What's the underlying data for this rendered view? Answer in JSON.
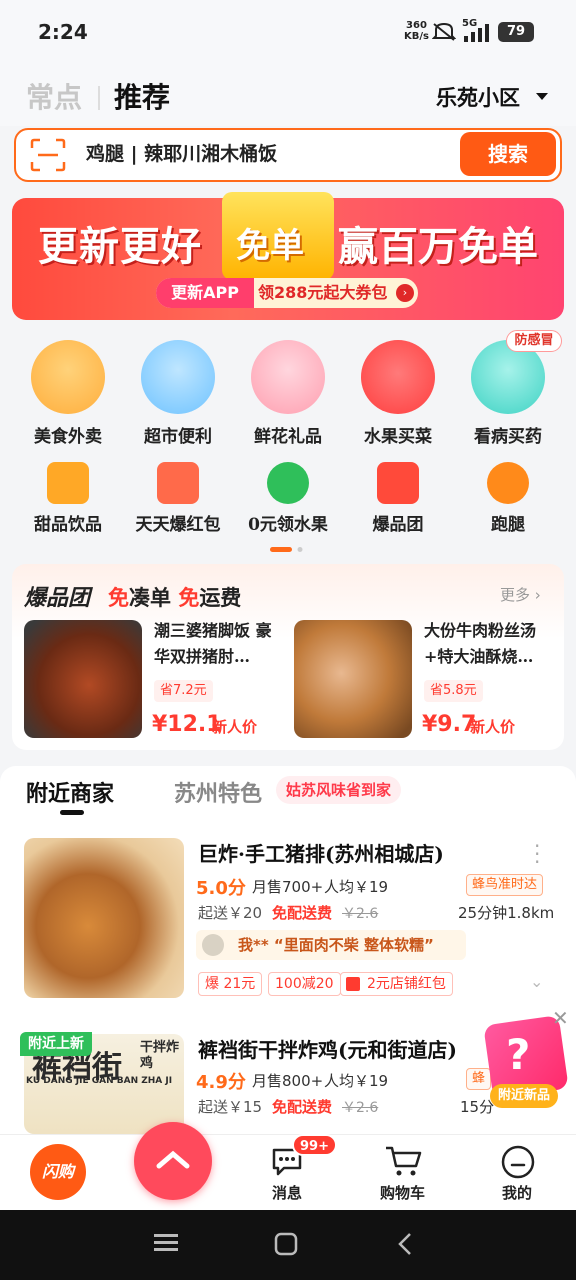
{
  "status_bar": {
    "time": "2:24",
    "speed_value": "360",
    "speed_unit": "KB/s",
    "network": "5G",
    "battery": "79"
  },
  "header": {
    "tab_frequent": "常点",
    "tab_recommend": "推荐",
    "location": "乐苑小区"
  },
  "search": {
    "placeholder": "鸡腿 | 辣耶川湘木桶饭",
    "button": "搜索"
  },
  "banner": {
    "left_text": "更新更好",
    "center_text": "免单",
    "right_text": "赢百万免单",
    "pill_left": "更新APP",
    "pill_right": "领288元起大券包"
  },
  "categories_row1": [
    {
      "label": "美食外卖",
      "icon": "noodle-bowl-icon",
      "color": "#ffb547"
    },
    {
      "label": "超市便利",
      "icon": "milk-carton-icon",
      "color": "#6fc3ff"
    },
    {
      "label": "鲜花礼品",
      "icon": "flower-bouquet-icon",
      "color": "#ff9fb0"
    },
    {
      "label": "水果买菜",
      "icon": "strawberry-icon",
      "color": "#ff5a5a"
    },
    {
      "label": "看病买药",
      "icon": "medicine-bottle-icon",
      "color": "#3fd3c4"
    }
  ],
  "categories_row2": [
    {
      "label": "甜品饮品",
      "icon": "drink-cup-icon",
      "color": "#ffa826"
    },
    {
      "label": "天天爆红包",
      "icon": "red-packet-icon",
      "color": "#ff6a4a"
    },
    {
      "label": "0元领水果",
      "icon": "tree-icon",
      "color": "#2fbf5a"
    },
    {
      "label": "爆品团",
      "icon": "group-buy-icon",
      "color": "#ff4a3a"
    },
    {
      "label": "跑腿",
      "icon": "runner-icon",
      "color": "#ff8a1a"
    }
  ],
  "medicine_badge": "防感冒",
  "baopin": {
    "logo": "爆品团",
    "tagline_a": "免",
    "tagline_b": "凑单",
    "tagline_c": "免",
    "tagline_d": "运费",
    "more": "更多",
    "deals": [
      {
        "title": "潮三婆猪脚饭 豪华双拼猪肘…",
        "save": "省7.2元",
        "price": "¥12.1",
        "tag": "新人价"
      },
      {
        "title": "大份牛肉粉丝汤+特大油酥烧…",
        "save": "省5.8元",
        "price": "¥9.7",
        "tag": "新人价"
      }
    ]
  },
  "merchant_tabs": {
    "nearby": "附近商家",
    "suzhou": "苏州特色",
    "suzhou_badge": "姑苏风味省到家"
  },
  "shops": [
    {
      "name": "巨炸·手工猪排(苏州相城店)",
      "rating": "5.0分",
      "monthly": "月售700+",
      "avg": "人均￥19",
      "delivery_tag": "蜂鸟准时达",
      "min_order": "起送￥20",
      "free_fee": "免配送费",
      "old_fee": "￥2.6",
      "eta": "25分钟1.8km",
      "review": "我** “里面肉不柴 整体软糯”",
      "promos": [
        "爆 21元",
        "100减20",
        "2元店铺红包"
      ]
    },
    {
      "name": "裤裆街干拌炸鸡(元和街道店)",
      "badge": "附近上新",
      "rating": "4.9分",
      "monthly": "月售800+",
      "avg": "人均￥19",
      "delivery_tag": "蜂",
      "min_order": "起送￥15",
      "free_fee": "免配送费",
      "old_fee": "￥2.6",
      "eta": "15分",
      "img_text_a": "裤裆街",
      "img_text_b": "干拌炸鸡",
      "img_text_c": "KU DANG JIE GAN BAN ZHA JI"
    }
  ],
  "float_gift": {
    "label": "附近新品"
  },
  "bottom_nav": {
    "flash": "闪购",
    "messages": "消息",
    "message_badge": "99+",
    "cart": "购物车",
    "mine": "我的"
  }
}
